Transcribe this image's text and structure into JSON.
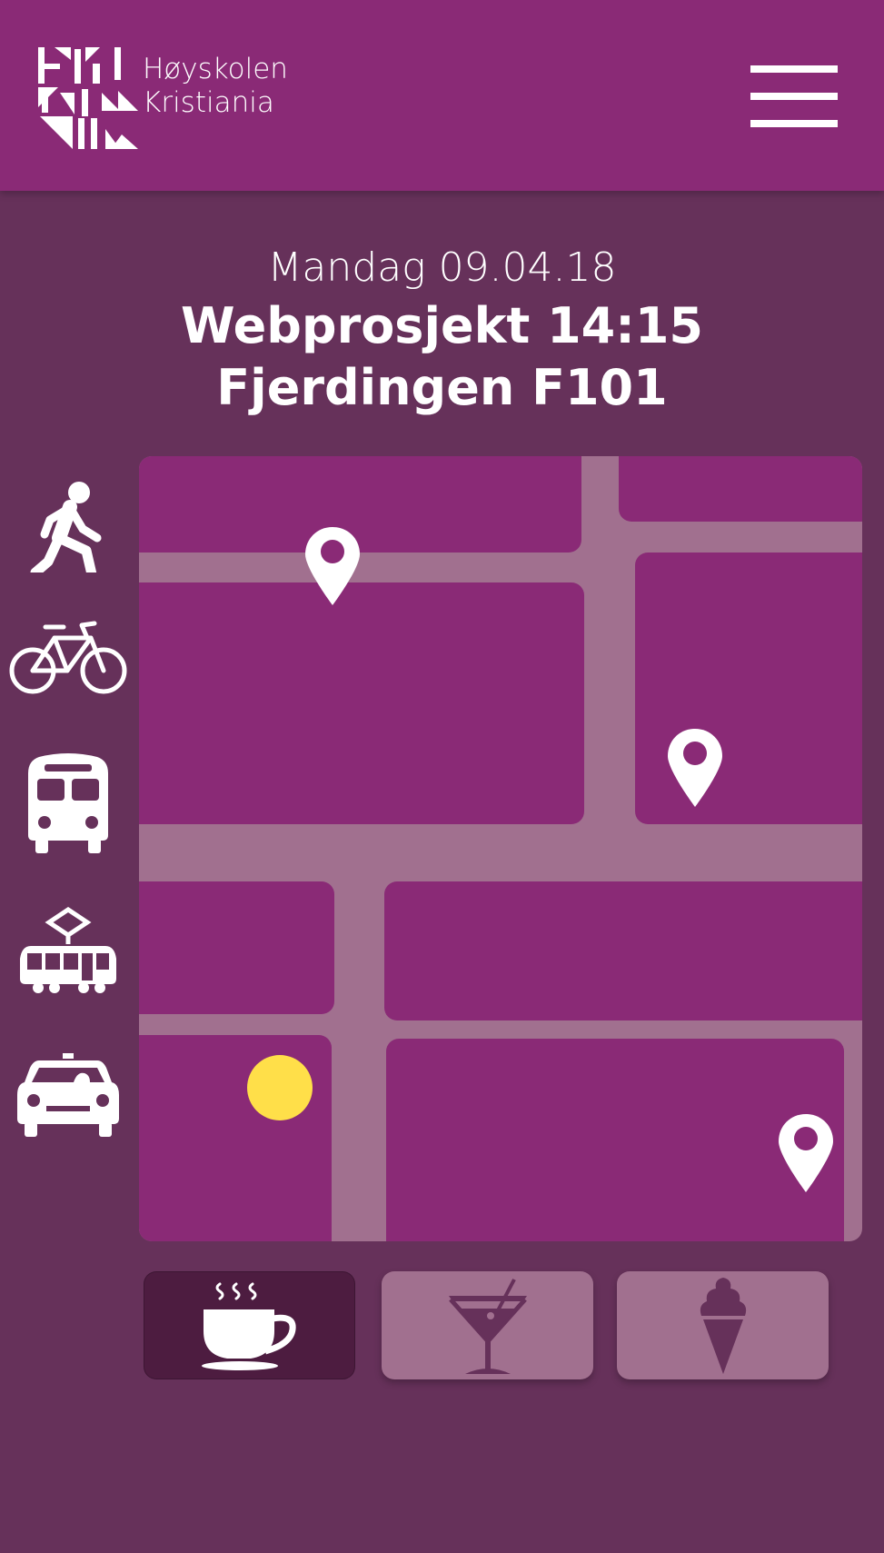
{
  "header": {
    "brand_line1": "Høyskolen",
    "brand_line2": "Kristiania",
    "menu_icon": "hamburger-menu-icon"
  },
  "event": {
    "date": "Mandag 09.04.18",
    "course": "Webprosjekt 14:15",
    "room": "Fjerdingen F101"
  },
  "transport_modes": [
    {
      "name": "walk",
      "icon": "walking-person-icon"
    },
    {
      "name": "bike",
      "icon": "bicycle-icon"
    },
    {
      "name": "bus",
      "icon": "bus-icon"
    },
    {
      "name": "tram",
      "icon": "tram-icon"
    },
    {
      "name": "taxi",
      "icon": "taxi-icon"
    }
  ],
  "map": {
    "pin_icon": "map-pin-icon",
    "location_marker": "current-location-dot"
  },
  "categories": [
    {
      "name": "coffee",
      "icon": "coffee-cup-icon",
      "active": true
    },
    {
      "name": "drinks",
      "icon": "cocktail-glass-icon",
      "active": false
    },
    {
      "name": "ice-cream",
      "icon": "ice-cream-cone-icon",
      "active": false
    }
  ],
  "colors": {
    "header": "#8a2a76",
    "background": "#66315a",
    "road": "#a1708f",
    "block": "#8a2a76",
    "location": "#ffdf49",
    "active_tab": "#4d1c40"
  }
}
